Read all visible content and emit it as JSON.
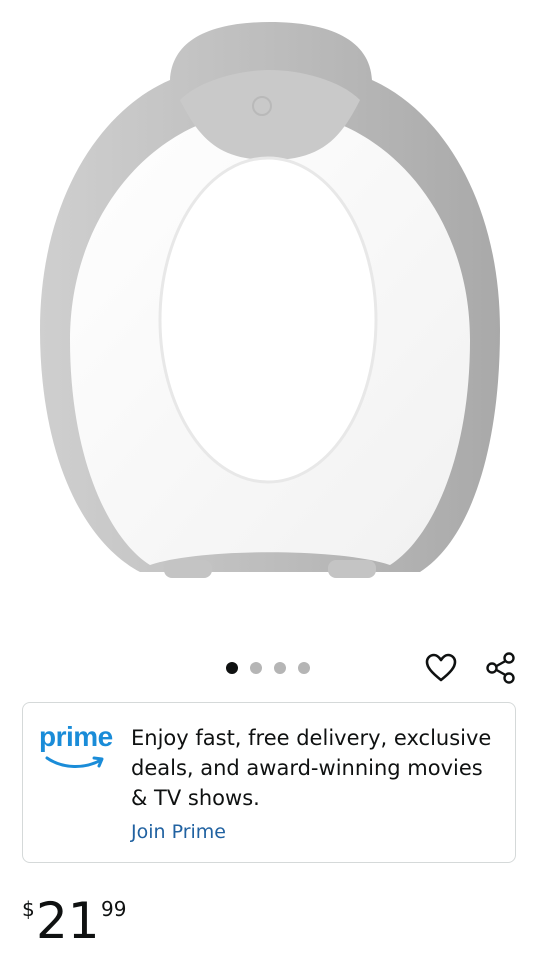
{
  "product": {
    "image_alt": "potty-training-seat",
    "image_count": 4,
    "active_image_index": 0
  },
  "actions": {
    "wishlist_icon": "heart-outline-icon",
    "share_icon": "share-icon"
  },
  "prime_banner": {
    "logo_text": "prime",
    "description": "Enjoy fast, free delivery, exclusive deals, and award-winning movies & TV shows.",
    "line1": "Enjoy fast, free delivery, exclusive",
    "line2": "deals, and award-winning movies",
    "line3": "& TV shows.",
    "join_label": "Join Prime",
    "brand_color": "#1a8cd8",
    "link_color": "#2162a1"
  },
  "price": {
    "symbol": "$",
    "whole": "21",
    "fraction": "99"
  }
}
